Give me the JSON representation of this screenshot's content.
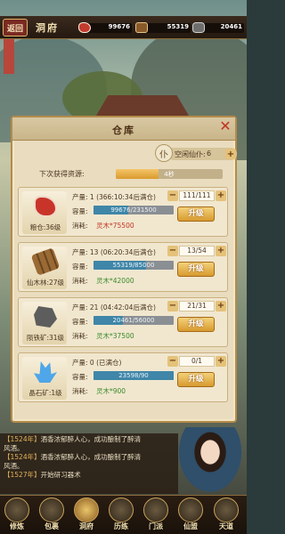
{
  "topbar": {
    "back_label": "返回",
    "title": "洞府",
    "resources": [
      {
        "name": "meat",
        "value": "99676"
      },
      {
        "name": "wood",
        "value": "55319"
      },
      {
        "name": "ore",
        "value": "20461"
      }
    ]
  },
  "dialog": {
    "title": "仓库",
    "idle_label": "空闲仙仆:",
    "idle_count": "6",
    "next_label": "下次获得资源:",
    "next_value": "4秒",
    "next_progress": 0.4,
    "cards": [
      {
        "name": "粮仓:36级",
        "icon": "meat-icon",
        "output": "产量: 1 (366:10:34后满仓)",
        "cap_label": "容量:",
        "capacity": "99676/231500",
        "cap_fill": 0.43,
        "cost_label": "消耗:",
        "cost": "灵木*75500",
        "cost_ok": false,
        "count": "111/111",
        "upgrade": "升级"
      },
      {
        "name": "仙木林:27级",
        "icon": "wood-icon",
        "output": "产量: 13 (06:20:34后满仓)",
        "cap_label": "容量:",
        "capacity": "55319/85000",
        "cap_fill": 0.65,
        "cost_label": "消耗:",
        "cost": "灵木*42000",
        "cost_ok": true,
        "count": "13/54",
        "upgrade": "升级"
      },
      {
        "name": "陨铁矿:31级",
        "icon": "ore-icon",
        "output": "产量: 21 (04:42:04后满仓)",
        "cap_label": "容量:",
        "capacity": "20461/56000",
        "cap_fill": 0.37,
        "cost_label": "消耗:",
        "cost": "灵木*37500",
        "cost_ok": true,
        "count": "21/31",
        "upgrade": "升级"
      },
      {
        "name": "晶石矿:1级",
        "icon": "crystal-icon",
        "output": "产量: 0 (已满仓)",
        "cap_label": "容量:",
        "capacity": "23598/90",
        "cap_fill": 1.0,
        "cost_label": "消耗:",
        "cost": "灵木*900",
        "cost_ok": true,
        "count": "0/1",
        "upgrade": "升级"
      }
    ]
  },
  "log": [
    {
      "year": "【1524年】",
      "text": "酒香浓郁醉人心，成功酿制了醉清",
      "bad": false
    },
    {
      "year": "",
      "text": "风酒。",
      "bad": false
    },
    {
      "year": "【1524年】",
      "text": "酒香浓郁醉人心，成功酿制了醉清",
      "bad": false
    },
    {
      "year": "",
      "text": "风酒。",
      "bad": false
    },
    {
      "year": "【1527年】",
      "text": "开始研习器术",
      "bad": false
    }
  ],
  "nav": [
    {
      "label": "修炼",
      "active": false
    },
    {
      "label": "包裹",
      "active": false
    },
    {
      "label": "洞府",
      "active": true
    },
    {
      "label": "历练",
      "active": false
    },
    {
      "label": "门派",
      "active": false
    },
    {
      "label": "仙盟",
      "active": false
    },
    {
      "label": "天道",
      "active": false
    }
  ]
}
